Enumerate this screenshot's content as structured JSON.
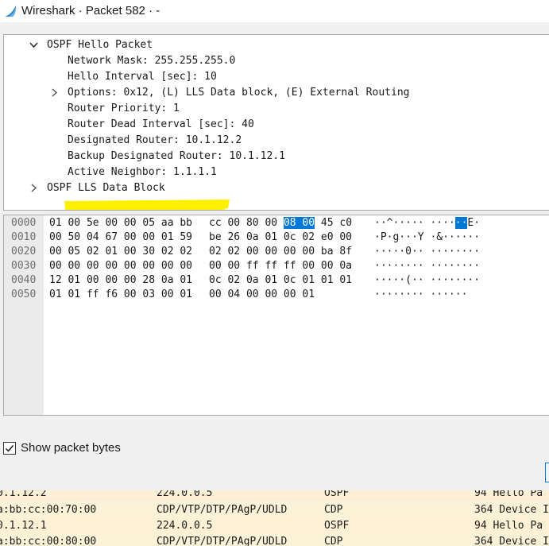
{
  "window": {
    "title": "Wireshark · Packet 582 · -"
  },
  "colors": {
    "selection": "#0078d7",
    "highlighter": "#ffef00",
    "cdp_row": "#fcf2d8",
    "ospf_row": "#fdf0d5"
  },
  "tree": {
    "items": [
      {
        "text": "OSPF Hello Packet",
        "expander": "expanded"
      },
      {
        "text": "Network Mask: 255.255.255.0"
      },
      {
        "text": "Hello Interval [sec]: 10"
      },
      {
        "text": "Options: 0x12, (L) LLS Data block, (E) External Routing",
        "expander": "collapsed"
      },
      {
        "text": "Router Priority: 1"
      },
      {
        "text": "Router Dead Interval [sec]: 40"
      },
      {
        "text": "Designated Router: 10.1.12.2"
      },
      {
        "text": "Backup Designated Router: 10.1.12.1"
      },
      {
        "text": "Active Neighbor: 1.1.1.1",
        "annotation": "yellow-highlighter"
      },
      {
        "text": "OSPF LLS Data Block",
        "expander": "collapsed"
      }
    ]
  },
  "hex": {
    "lines": [
      {
        "offset": "0000",
        "bytes_a": "01 00 5e 00 00 05 aa bb",
        "bytes_b1": "cc 00 80 00 ",
        "bytes_b_sel": "08 00",
        "bytes_b2": " 45 c0",
        "ascii_1": "··^····· ····",
        "ascii_sel": "··",
        "ascii_2": "E·"
      },
      {
        "offset": "0010",
        "bytes_a": "00 50 04 67 00 00 01 59",
        "bytes_b": "be 26 0a 01 0c 02 e0 00",
        "ascii": "·P·g···Y ·&······"
      },
      {
        "offset": "0020",
        "bytes_a": "00 05 02 01 00 30 02 02",
        "bytes_b": "02 02 00 00 00 00 ba 8f",
        "ascii": "·····0·· ········"
      },
      {
        "offset": "0030",
        "bytes_a": "00 00 00 00 00 00 00 00",
        "bytes_b": "00 00 ff ff ff 00 00 0a",
        "ascii": "········ ········"
      },
      {
        "offset": "0040",
        "bytes_a": "12 01 00 00 00 28 0a 01",
        "bytes_b": "0c 02 0a 01 0c 01 01 01",
        "ascii": "·····(·· ········"
      },
      {
        "offset": "0050",
        "bytes_a": "01 01 ff f6 00 03 00 01",
        "bytes_b": "00 04 00 00 00 01",
        "ascii": "········ ······"
      }
    ]
  },
  "show_packet_bytes": {
    "label": "Show packet bytes",
    "checked": true
  },
  "packet_list": {
    "rows": [
      {
        "source": "0.1.12.2",
        "destination": "224.0.0.5",
        "protocol": "OSPF",
        "info": "94 Hello Pa",
        "row_type": "ospf"
      },
      {
        "source": "a:bb:cc:00:70:00",
        "destination": "CDP/VTP/DTP/PAgP/UDLD",
        "protocol": "CDP",
        "info": "364 Device I",
        "row_type": "cdp"
      },
      {
        "source": "0.1.12.1",
        "destination": "224.0.0.5",
        "protocol": "OSPF",
        "info": " 94 Hello Pa",
        "row_type": "ospf"
      },
      {
        "source": "a:bb:cc:00:80:00",
        "destination": "CDP/VTP/DTP/PAgP/UDLD",
        "protocol": "CDP",
        "info": "364 Device I",
        "row_type": "cdp"
      }
    ]
  }
}
